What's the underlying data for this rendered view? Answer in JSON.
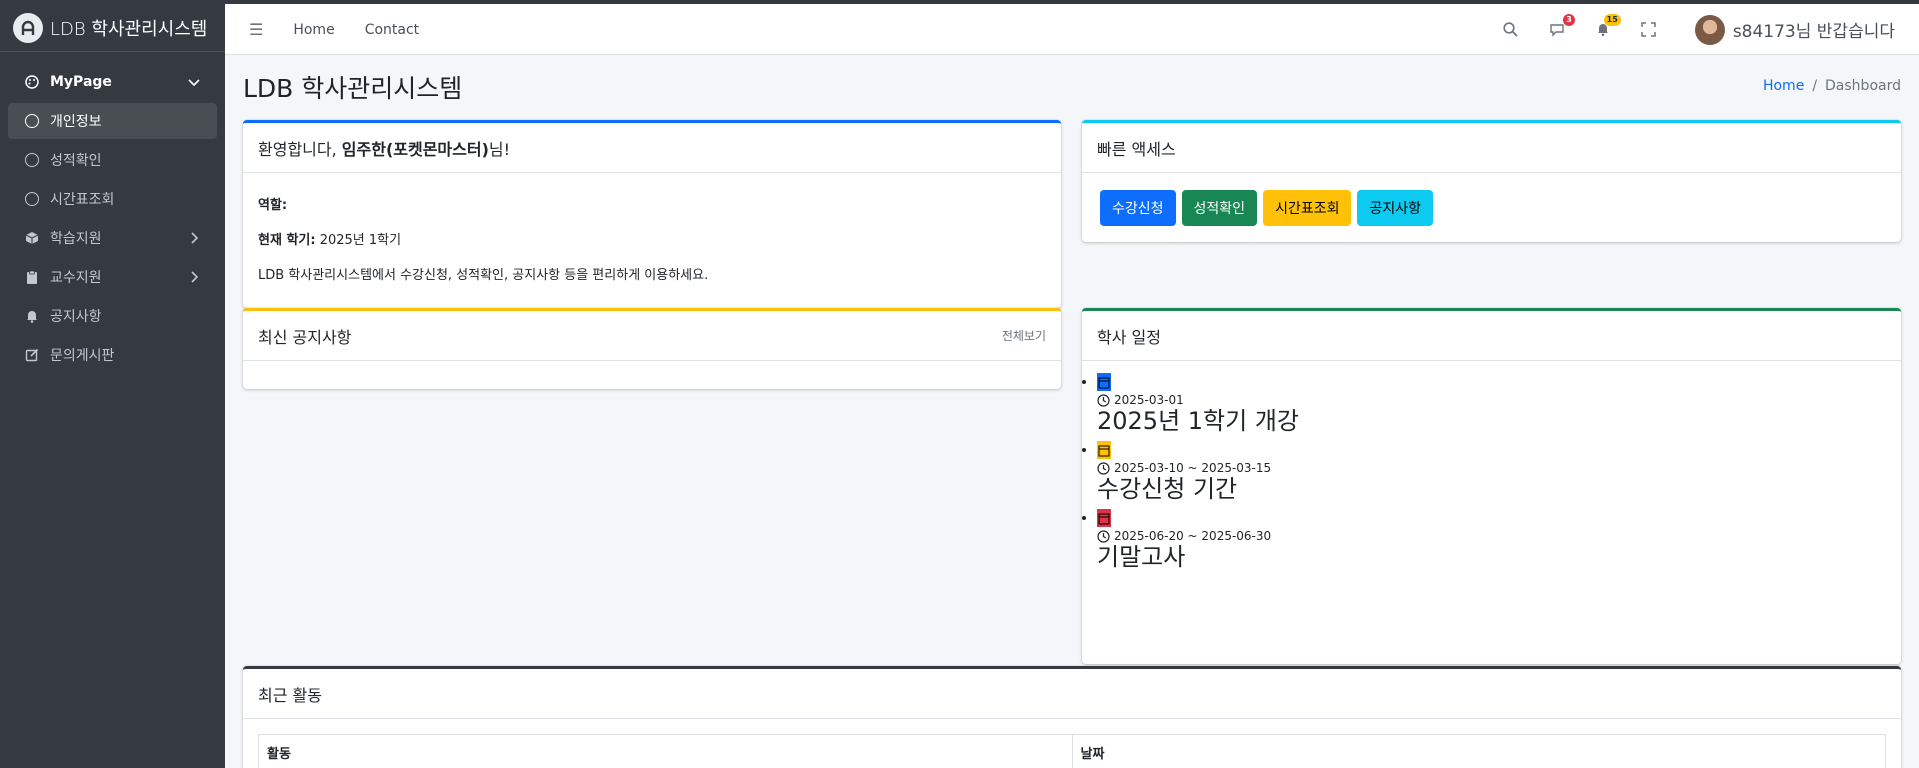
{
  "brand": {
    "name": "LDB 학사관리시스템"
  },
  "sidebar": {
    "items": [
      {
        "label": "MyPage",
        "icon": "palette-icon"
      },
      {
        "label": "개인정보",
        "icon": "circle-icon"
      },
      {
        "label": "성적확인",
        "icon": "circle-icon"
      },
      {
        "label": "시간표조회",
        "icon": "circle-icon"
      },
      {
        "label": "학습지원",
        "icon": "box-icon"
      },
      {
        "label": "교수지원",
        "icon": "clipboard-icon"
      },
      {
        "label": "공지사항",
        "icon": "bell-icon"
      },
      {
        "label": "문의게시판",
        "icon": "edit-icon"
      }
    ]
  },
  "navbar": {
    "links": [
      "Home",
      "Contact"
    ],
    "messages_badge": "3",
    "notifications_badge": "15",
    "user_greeting": "s84173님 반갑습니다"
  },
  "page": {
    "title": "LDB 학사관리시스템",
    "breadcrumb": {
      "home": "Home",
      "sep": "/",
      "current": "Dashboard"
    }
  },
  "welcome": {
    "prefix": "환영합니다, ",
    "name": "임주한(포켓몬마스터)",
    "suffix": "님!",
    "role_label": "역할:",
    "semester_label": "현재 학기:",
    "semester_value": "2025년 1학기",
    "description": "LDB 학사관리시스템에서 수강신청, 성적확인, 공지사항 등을 편리하게 이용하세요."
  },
  "quick_access": {
    "title": "빠른 액세스",
    "buttons": [
      "수강신청",
      "성적확인",
      "시간표조회",
      "공지사항"
    ]
  },
  "notices": {
    "title": "최신 공지사항",
    "more": "전체보기"
  },
  "schedule": {
    "title": "학사 일정",
    "events": [
      {
        "date": "2025-03-01",
        "title": "2025년 1학기 개강",
        "color": "#0d6efd"
      },
      {
        "date": "2025-03-10 ~ 2025-03-15",
        "title": "수강신청 기간",
        "color": "#ffc107"
      },
      {
        "date": "2025-06-20 ~ 2025-06-30",
        "title": "기말고사",
        "color": "#dc3545"
      }
    ]
  },
  "activity": {
    "title": "최근 활동",
    "columns": [
      "활동",
      "날짜"
    ]
  }
}
